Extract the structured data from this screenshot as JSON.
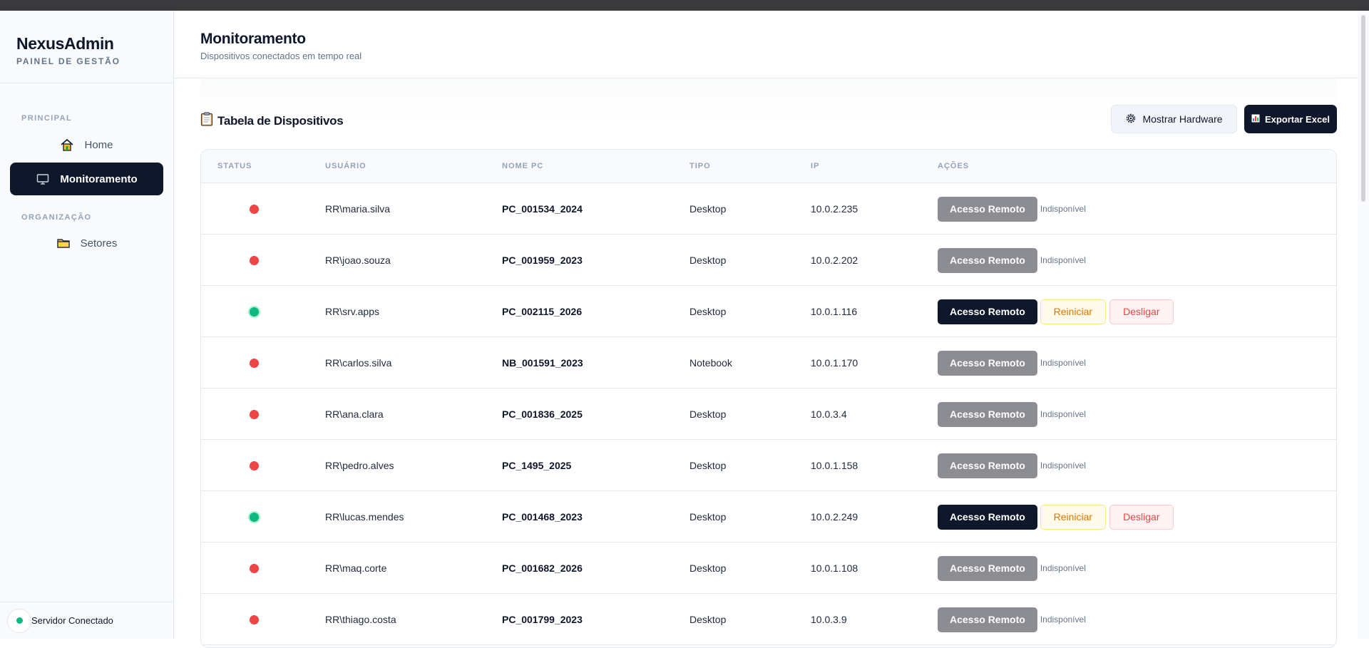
{
  "brand": {
    "name": "NexusAdmin",
    "subtitle": "PAINEL DE GESTÃO"
  },
  "sidebar": {
    "sections": [
      {
        "title": "PRINCIPAL",
        "items": [
          {
            "label": "Home",
            "icon": "home-icon"
          },
          {
            "label": "Monitoramento",
            "icon": "monitor-icon",
            "active": true
          }
        ]
      },
      {
        "title": "ORGANIZAÇÃO",
        "items": [
          {
            "label": "Setores",
            "icon": "folder-icon"
          }
        ]
      }
    ]
  },
  "server_status": {
    "label": "Servidor Conectado",
    "color": "#10b981"
  },
  "header": {
    "title": "Monitoramento",
    "subtitle": "Dispositivos conectados em tempo real"
  },
  "table": {
    "title": "Tabela de Dispositivos",
    "title_icon": "clipboard-icon",
    "buttons": {
      "hardware": "Mostrar Hardware",
      "export": "Exportar Excel"
    },
    "columns": [
      "STATUS",
      "USUÁRIO",
      "NOME PC",
      "TIPO",
      "IP",
      "AÇÕES"
    ],
    "rows": [
      {
        "online": false,
        "user": "RR\\maria.silva",
        "pc": "PC_001534_2024",
        "type": "Desktop",
        "ip": "10.0.2.235"
      },
      {
        "online": false,
        "user": "RR\\joao.souza",
        "pc": "PC_001959_2023",
        "type": "Desktop",
        "ip": "10.0.2.202"
      },
      {
        "online": true,
        "user": "RR\\srv.apps",
        "pc": "PC_002115_2026",
        "type": "Desktop",
        "ip": "10.0.1.116"
      },
      {
        "online": false,
        "user": "RR\\carlos.silva",
        "pc": "NB_001591_2023",
        "type": "Notebook",
        "ip": "10.0.1.170"
      },
      {
        "online": false,
        "user": "RR\\ana.clara",
        "pc": "PC_001836_2025",
        "type": "Desktop",
        "ip": "10.0.3.4"
      },
      {
        "online": false,
        "user": "RR\\pedro.alves",
        "pc": "PC_1495_2025",
        "type": "Desktop",
        "ip": "10.0.1.158"
      },
      {
        "online": true,
        "user": "RR\\lucas.mendes",
        "pc": "PC_001468_2023",
        "type": "Desktop",
        "ip": "10.0.2.249"
      },
      {
        "online": false,
        "user": "RR\\maq.corte",
        "pc": "PC_001682_2026",
        "type": "Desktop",
        "ip": "10.0.1.108"
      },
      {
        "online": false,
        "user": "RR\\thiago.costa",
        "pc": "PC_001799_2023",
        "type": "Desktop",
        "ip": "10.0.3.9"
      }
    ],
    "actions": {
      "remote": "Acesso Remoto",
      "unavailable": "Indisponível",
      "restart": "Reiniciar",
      "shutdown": "Desligar"
    }
  }
}
